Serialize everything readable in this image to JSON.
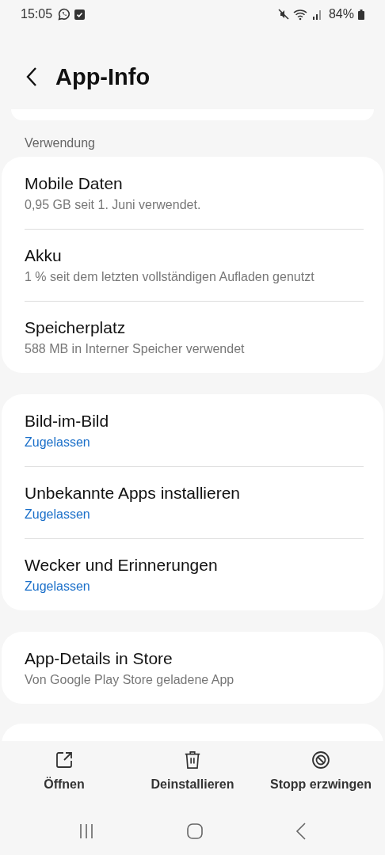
{
  "status_bar": {
    "time": "15:05",
    "battery": "84%"
  },
  "header": {
    "title": "App-Info"
  },
  "sections": [
    {
      "label": "Verwendung",
      "items": [
        {
          "title": "Mobile Daten",
          "subtitle": "0,95 GB seit 1. Juni verwendet.",
          "kind": "detail"
        },
        {
          "title": "Akku",
          "subtitle": "1 % seit dem letzten vollständigen Aufladen genutzt",
          "kind": "detail"
        },
        {
          "title": "Speicherplatz",
          "subtitle": "588 MB in Interner Speicher verwendet",
          "kind": "detail"
        }
      ]
    },
    {
      "items": [
        {
          "title": "Bild-im-Bild",
          "subtitle": "Zugelassen",
          "kind": "status"
        },
        {
          "title": "Unbekannte Apps installieren",
          "subtitle": "Zugelassen",
          "kind": "status"
        },
        {
          "title": "Wecker und Erinnerungen",
          "subtitle": "Zugelassen",
          "kind": "status"
        }
      ]
    },
    {
      "items": [
        {
          "title": "App-Details in Store",
          "subtitle": "Von Google Play Store geladene App",
          "kind": "detail"
        }
      ]
    }
  ],
  "actions": [
    {
      "label": "Öffnen",
      "kind": "open"
    },
    {
      "label": "Deinstallieren",
      "kind": "uninstall"
    },
    {
      "label": "Stopp erzwingen",
      "kind": "stop"
    }
  ]
}
